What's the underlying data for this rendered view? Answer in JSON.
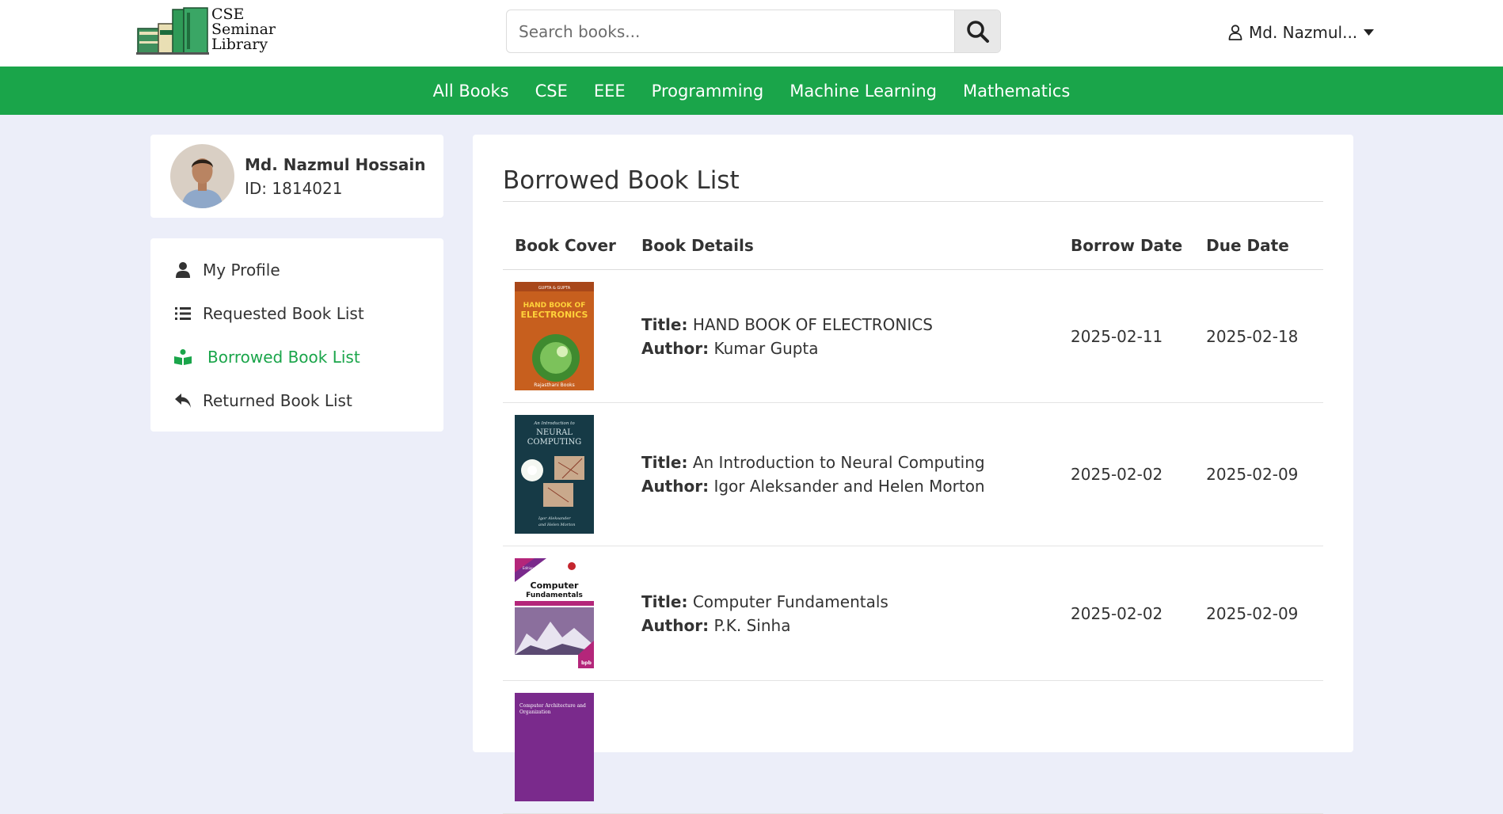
{
  "header": {
    "logo": {
      "line1": "CSE",
      "line2": "Seminar",
      "line3": "Library"
    },
    "search": {
      "placeholder": "Search books..."
    },
    "user_menu": {
      "name": "Md. Nazmul..."
    }
  },
  "nav": {
    "items": [
      "All Books",
      "CSE",
      "EEE",
      "Programming",
      "Machine Learning",
      "Mathematics"
    ]
  },
  "profile": {
    "name": "Md. Nazmul Hossain",
    "id_text": "ID: 1814021"
  },
  "sidebar": {
    "items": [
      {
        "label": "My Profile",
        "icon": "user-icon"
      },
      {
        "label": "Requested Book List",
        "icon": "list-icon"
      },
      {
        "label": "Borrowed Book List",
        "icon": "open-book-icon",
        "active": true
      },
      {
        "label": "Returned Book List",
        "icon": "reply-arrow-icon"
      }
    ]
  },
  "main": {
    "title": "Borrowed Book List",
    "columns": [
      "Book Cover",
      "Book Details",
      "Borrow Date",
      "Due Date"
    ],
    "title_label": "Title:",
    "author_label": "Author:",
    "rows": [
      {
        "title": "HAND BOOK OF ELECTRONICS",
        "author": "Kumar Gupta",
        "borrow_date": "2025-02-11",
        "due_date": "2025-02-18",
        "cover": {
          "top_text": "GUPTA & GUPTA",
          "title_text": "HAND BOOK OF ELECTRONICS",
          "footer_text": "Rajasthani Books",
          "bg": "#c75f1e"
        }
      },
      {
        "title": "An Introduction to Neural Computing",
        "author": "Igor Aleksander and Helen Morton",
        "borrow_date": "2025-02-02",
        "due_date": "2025-02-09",
        "cover": {
          "top_text": "An Introduction to",
          "title_text": "NEURAL COMPUTING",
          "footer_text": "Igor Aleksander and Helen Morton",
          "bg": "#163a46"
        }
      },
      {
        "title": "Computer Fundamentals",
        "author": "P.K. Sinha",
        "borrow_date": "2025-02-02",
        "due_date": "2025-02-09",
        "cover": {
          "top_text": "Edition",
          "title_text": "Computer Fundamentals",
          "footer_text": "bpb",
          "bg": "#b4267a"
        }
      },
      {
        "title": "",
        "author": "",
        "borrow_date": "",
        "due_date": "",
        "cover": {
          "top_text": "Computer Architecture and Organization",
          "title_text": "",
          "footer_text": "",
          "bg": "#7a2a8c"
        }
      }
    ]
  },
  "colors": {
    "brand_green": "#1aa54a",
    "page_bg": "#eceef9"
  }
}
